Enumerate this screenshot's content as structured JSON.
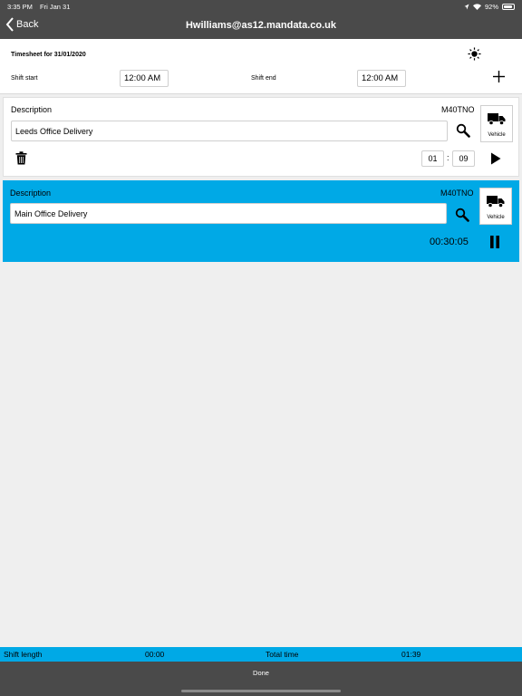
{
  "status": {
    "time": "3:35 PM",
    "date": "Fri Jan 31",
    "battery": "92%",
    "battery_level": 0.92
  },
  "nav": {
    "back_label": "Back",
    "title": "Hwilliams@as12.mandata.co.uk"
  },
  "timesheet": {
    "title": "Timesheet for 31/01/2020",
    "shift_start_label": "Shift start",
    "shift_start_value": "12:00 AM",
    "shift_end_label": "Shift end",
    "shift_end_value": "12:00 AM"
  },
  "jobs": [
    {
      "description_label": "Description",
      "vehicle_code": "M40TNO",
      "description": "Leeds Office Delivery",
      "vehicle_button_label": "Vehicle",
      "hours": "01",
      "minutes": "09"
    },
    {
      "description_label": "Description",
      "vehicle_code": "M40TNO",
      "description": "Main Office Delivery",
      "vehicle_button_label": "Vehicle",
      "timer": "00:30:05"
    }
  ],
  "footer": {
    "shift_length_label": "Shift length",
    "shift_length_value": "00:00",
    "total_time_label": "Total time",
    "total_time_value": "01:39",
    "done_label": "Done"
  },
  "colors": {
    "accent": "#00a9e6",
    "bar": "#4a4a4a",
    "background": "#efefef"
  }
}
